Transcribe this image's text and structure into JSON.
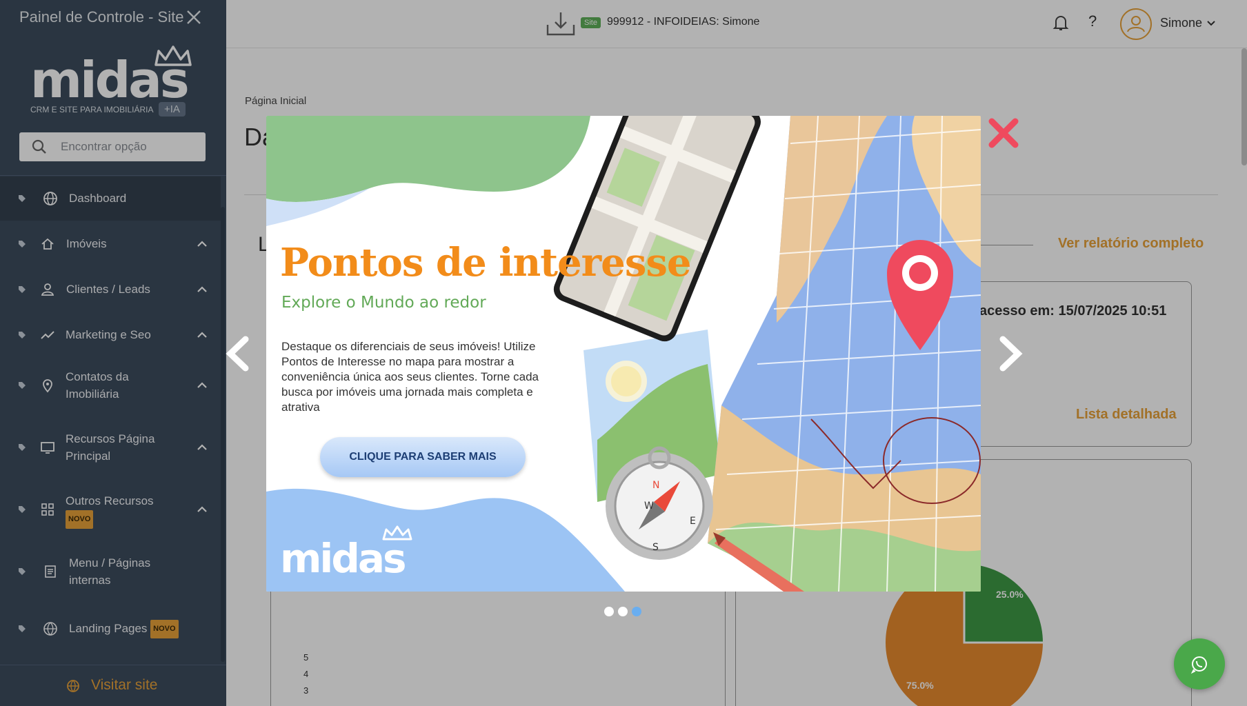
{
  "sidebar": {
    "title": "Painel de Controle - Site",
    "logo": {
      "name": "midas",
      "tagline": "CRM E SITE PARA IMOBILIÁRIA",
      "ia_badge": "+IA"
    },
    "search_placeholder": "Encontrar opção",
    "items": [
      {
        "label": "Dashboard",
        "icon": "globe-icon",
        "active": true
      },
      {
        "label": "Imóveis",
        "icon": "home-icon"
      },
      {
        "label": "Clientes / Leads",
        "icon": "user-icon"
      },
      {
        "label": "Marketing e Seo",
        "icon": "trend-icon"
      },
      {
        "label": "Contatos da",
        "label2": "Imobiliária",
        "icon": "pin-icon"
      },
      {
        "label": "Recursos Página",
        "label2": "Principal",
        "icon": "monitor-icon"
      },
      {
        "label": "Outros Recursos",
        "badge": "NOVO",
        "icon": "grid-icon"
      },
      {
        "label": "Menu / Páginas",
        "label2": "internas",
        "icon": "page-icon"
      },
      {
        "label": "Landing Pages",
        "badge": "NOVO",
        "icon": "web-icon"
      }
    ],
    "footer_label": "Visitar site"
  },
  "topbar": {
    "site_tag": "Site",
    "site_name": "999912 - INFOIDEIAS: Simone",
    "help": "?",
    "user": "Simone"
  },
  "main": {
    "breadcrumb": "Página Inicial",
    "title_partial": "Da",
    "section_partial": "L",
    "see_report": "Ver relatório completo",
    "last_access": "acesso em: 15/07/2025 10:51",
    "list_detail": "Lista detalhada",
    "ticks": [
      "5",
      "4",
      "3"
    ],
    "pie_labels": [
      "25.0%",
      "75.0%"
    ]
  },
  "modal": {
    "title": "Pontos de interesse",
    "subtitle": "Explore o Mundo ao redor",
    "body": "Destaque os diferenciais de seus imóveis! Utilize Pontos de Interesse no mapa para mostrar a conveniência única aos seus clientes. Torne cada busca por imóveis uma jornada mais completa e atrativa",
    "button": "CLIQUE PARA SABER MAIS",
    "logo": "midas",
    "carousel": {
      "total": 3,
      "active": 3
    }
  },
  "colors": {
    "sidebar_bg": "#3d4c5e",
    "accent": "#e9a23a",
    "promo_orange": "#f28c1a",
    "promo_green": "#62a957",
    "close_red": "#ef4a5e",
    "whatsapp": "#4aa84a"
  }
}
